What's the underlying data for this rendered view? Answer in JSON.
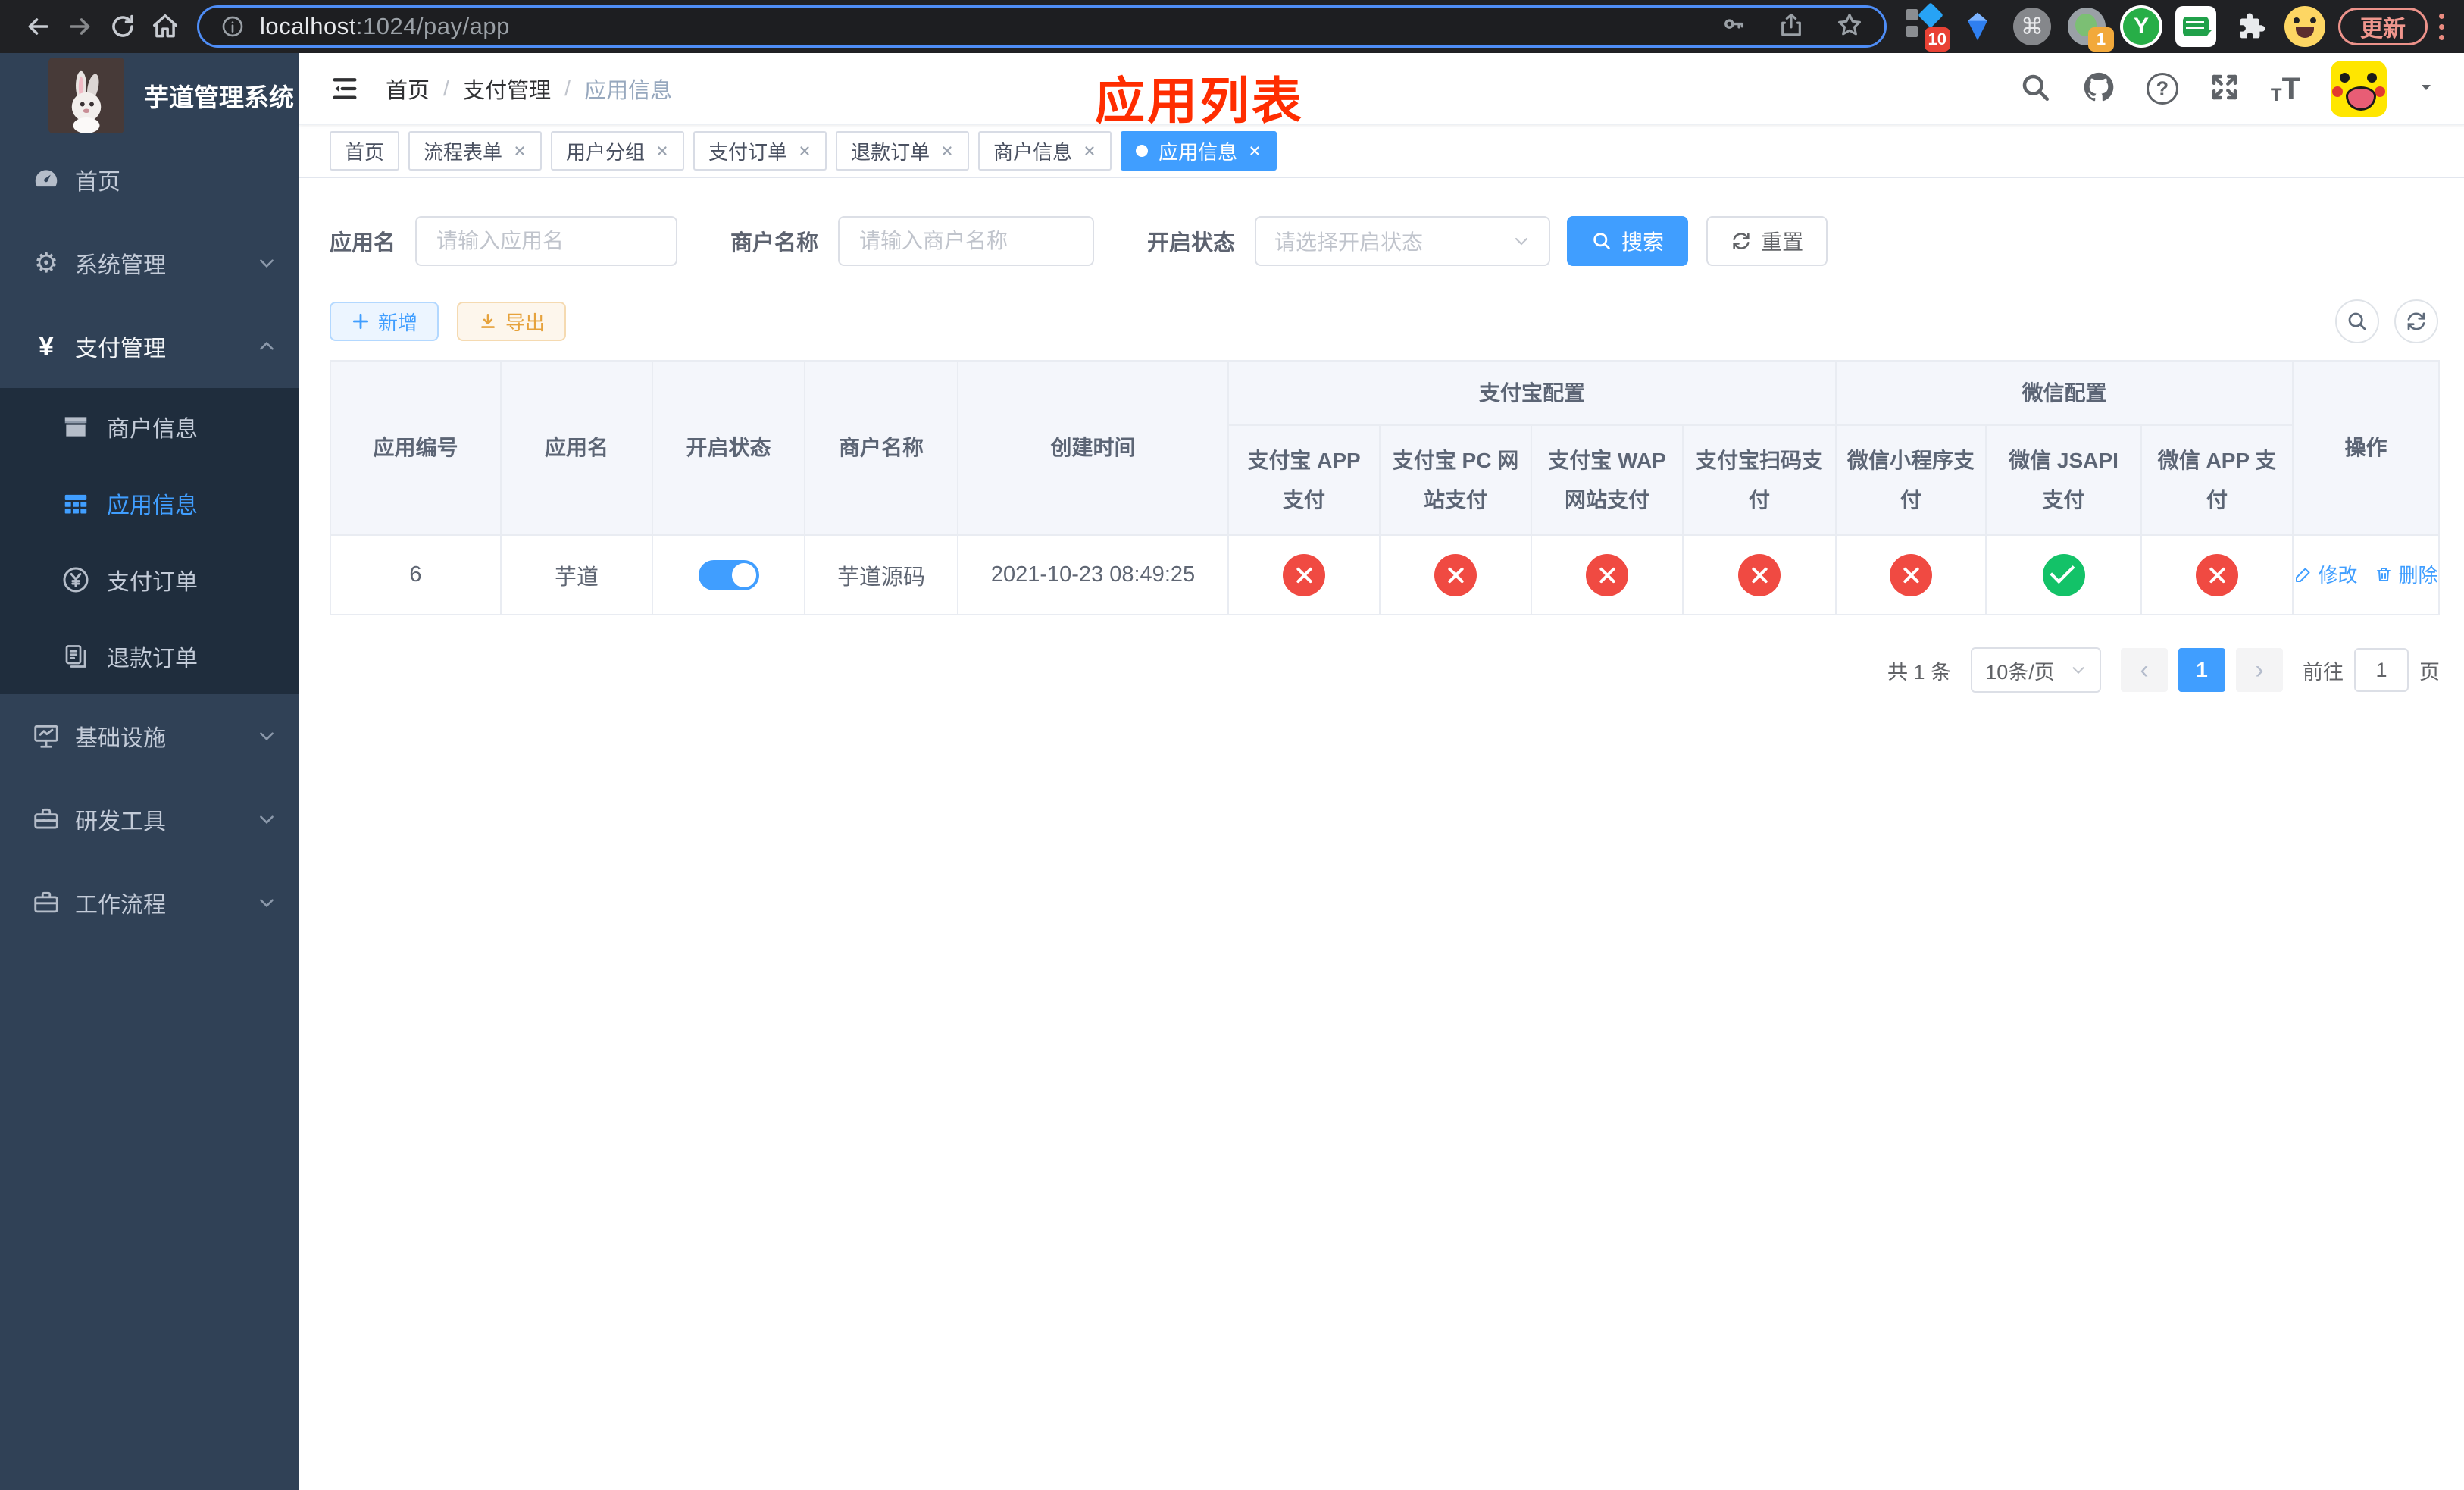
{
  "browser": {
    "url_host": "localhost",
    "url_rest": ":1024/pay/app",
    "update_label": "更新",
    "ext_badge_blue": "10",
    "ext_badge_avatar": "1",
    "ext_y": "Y",
    "ext_cmd": "⌘"
  },
  "sidebar": {
    "title": "芋道管理系统",
    "items": {
      "home": "首页",
      "system": "系统管理",
      "pay": "支付管理",
      "merchant": "商户信息",
      "app_info": "应用信息",
      "pay_order": "支付订单",
      "refund_order": "退款订单",
      "infra": "基础设施",
      "dev_tools": "研发工具",
      "workflow": "工作流程"
    }
  },
  "header": {
    "breadcrumb": {
      "home": "首页",
      "pay": "支付管理",
      "app": "应用信息"
    },
    "annotation": "应用列表",
    "help_mark": "?",
    "font_small": "T",
    "font_big": "T"
  },
  "tabs": {
    "items": [
      {
        "label": "首页"
      },
      {
        "label": "流程表单"
      },
      {
        "label": "用户分组"
      },
      {
        "label": "支付订单"
      },
      {
        "label": "退款订单"
      },
      {
        "label": "商户信息"
      },
      {
        "label": "应用信息"
      }
    ]
  },
  "filters": {
    "app_name_label": "应用名",
    "app_name_placeholder": "请输入应用名",
    "merchant_label": "商户名称",
    "merchant_placeholder": "请输入商户名称",
    "status_label": "开启状态",
    "status_placeholder": "请选择开启状态",
    "search_label": "搜索",
    "reset_label": "重置"
  },
  "toolbar": {
    "add_label": "新增",
    "export_label": "导出"
  },
  "table": {
    "headers": {
      "app_id": "应用编号",
      "app_name": "应用名",
      "status": "开启状态",
      "merchant": "商户名称",
      "create_time": "创建时间",
      "alipay_group": "支付宝配置",
      "wechat_group": "微信配置",
      "action": "操作",
      "alipay_app": "支付宝 APP 支付",
      "alipay_pc": "支付宝 PC 网站支付",
      "alipay_wap": "支付宝 WAP 网站支付",
      "alipay_qr": "支付宝扫码支付",
      "wx_lite": "微信小程序支付",
      "wx_jsapi": "微信 JSAPI 支付",
      "wx_app": "微信 APP 支付"
    },
    "row": {
      "app_id": "6",
      "app_name": "芋道",
      "merchant": "芋道源码",
      "create_time": "2021-10-23 08:49:25",
      "status_on": true,
      "configs": [
        "off",
        "off",
        "off",
        "off",
        "off",
        "on",
        "off"
      ],
      "edit_label": "修改",
      "delete_label": "删除"
    }
  },
  "pagination": {
    "total": "共 1 条",
    "page_size": "10条/页",
    "prev": "‹",
    "page": "1",
    "next": "›",
    "goto_label": "前往",
    "goto_value": "1",
    "unit_label": "页"
  }
}
